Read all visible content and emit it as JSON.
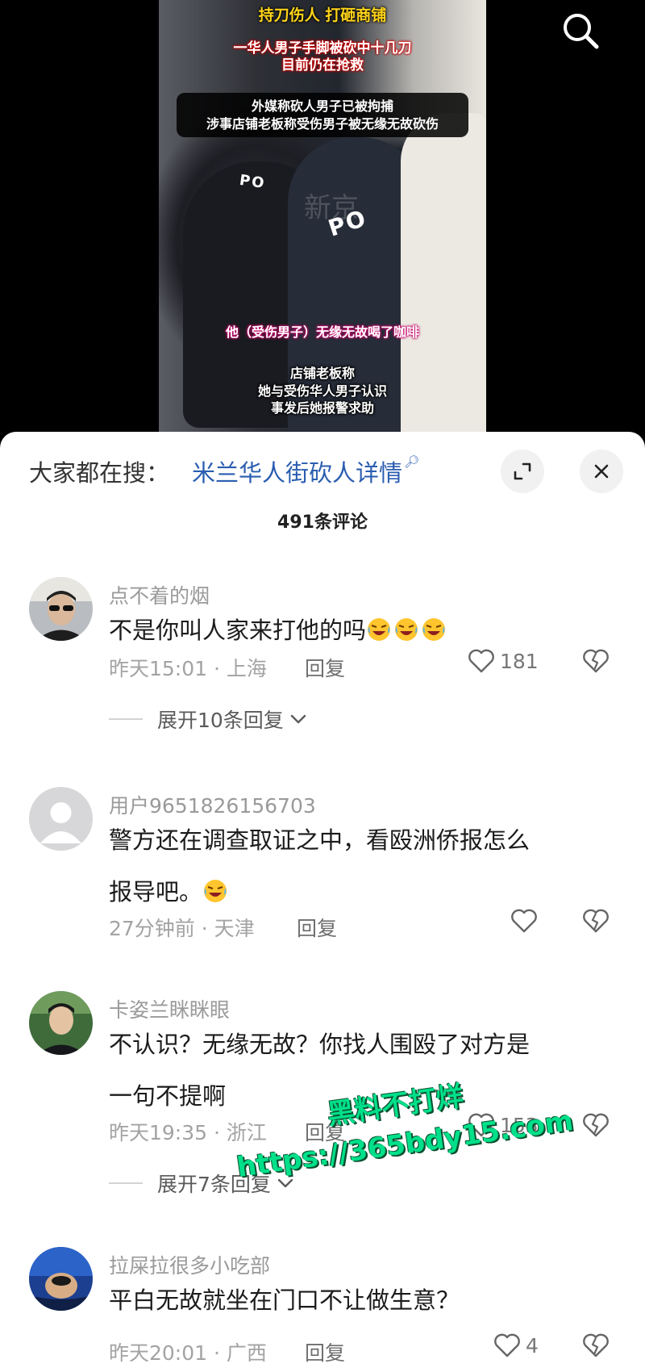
{
  "video": {
    "caption_title": "持刀伤人 打砸商铺",
    "caption_sub_1": "一华人男子手脚被砍中十几刀",
    "caption_sub_2": "目前仍在抢救",
    "caption_box_1": "外媒称砍人男子已被拘捕",
    "caption_box_2": "涉事店铺老板称受伤男子被无缘无故砍伤",
    "caption_coffee": "他（受伤男子）无缘无故喝了咖啡",
    "caption_boss_1": "店铺老板称",
    "caption_boss_2": "她与受伤华人男子认识",
    "caption_boss_3": "事发后她报警求助",
    "patch_text": "PO",
    "patch_text_2": "PO",
    "corner_mark": "新京"
  },
  "header": {
    "search_icon": "search-icon",
    "trend_label": "大家都在搜：",
    "trend_link": "米兰华人街砍人详情",
    "comment_count": "491条评论"
  },
  "comments": [
    {
      "user": "点不着的烟",
      "text": "不是你叫人家来打他的吗",
      "emoji_count": 3,
      "time_loc": "昨天15:01 · 上海",
      "reply": "回复",
      "likes": "181",
      "expand": "展开10条回复"
    },
    {
      "user": "用户9651826156703",
      "text_line1": "警方还在调查取证之中，看殴洲侨报怎么",
      "text_line2": "报导吧。",
      "time_loc": "27分钟前 · 天津",
      "reply": "回复"
    },
    {
      "user": "卡姿兰眯眯眼",
      "text_line1": "不认识？无缘无故？你找人围殴了对方是",
      "text_line2": "一句不提啊",
      "time_loc": "昨天19:35 · 浙江",
      "reply": "回复",
      "likes": "153",
      "expand": "展开7条回复"
    },
    {
      "user": "拉屎拉很多小吃部",
      "text": "平白无故就坐在门口不让做生意？",
      "time_loc": "昨天20:01 · 广西",
      "reply": "回复",
      "likes": "4"
    }
  ],
  "watermark": {
    "line1": "黑料不打烊",
    "line2": "https://365bdy15.com"
  },
  "colors": {
    "accent_link": "#2a5db0",
    "caption_yellow": "#ffd319",
    "watermark_green": "#00e08a"
  }
}
